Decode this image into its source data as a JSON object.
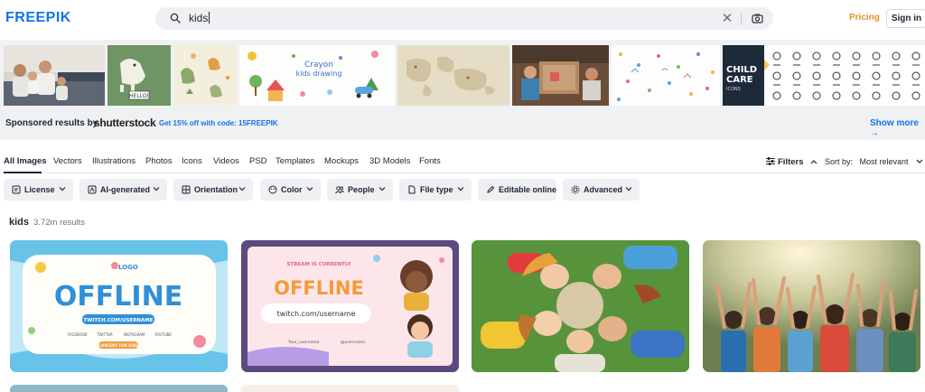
{
  "header": {
    "logo": "FREEPIK",
    "search_value": "kids",
    "pricing": "Pricing",
    "signin": "Sign in"
  },
  "sponsored": {
    "label": "Sponsored results by",
    "brand": "shutterstock",
    "offer": "Get 15% off with code: 15FREEPIK",
    "show_more": "Show more →",
    "thumb_texts": {
      "crayon": "Crayon\nkids drawing",
      "childcare_title_1": "CHILD",
      "childcare_title_2": "CARE",
      "childcare_sub": "ICONS",
      "hello": "HELLO!"
    }
  },
  "tabs": [
    {
      "label": "All Images",
      "active": true
    },
    {
      "label": "Vectors"
    },
    {
      "label": "Illustrations"
    },
    {
      "label": "Photos"
    },
    {
      "label": "Icons"
    },
    {
      "label": "Videos"
    },
    {
      "label": "PSD"
    },
    {
      "label": "Templates"
    },
    {
      "label": "Mockups"
    },
    {
      "label": "3D Models"
    },
    {
      "label": "Fonts"
    }
  ],
  "toolbar": {
    "filters": "Filters",
    "sort_label": "Sort by:",
    "sort_value": "Most relevant"
  },
  "chips": [
    {
      "label": "License",
      "icon": "license-icon"
    },
    {
      "label": "AI-generated",
      "icon": "ai-icon"
    },
    {
      "label": "Orientation",
      "icon": "orientation-icon"
    },
    {
      "label": "Color",
      "icon": "palette-icon"
    },
    {
      "label": "People",
      "icon": "people-icon"
    },
    {
      "label": "File type",
      "icon": "file-icon"
    },
    {
      "label": "Editable online",
      "icon": "pen-icon"
    },
    {
      "label": "Advanced",
      "icon": "gear-icon"
    }
  ],
  "results": {
    "query": "kids",
    "count": "3.72m results"
  },
  "cards": {
    "card1": {
      "logo": "LOGO",
      "title": "OFFLINE",
      "url": "TWITCH.COM/USERNAME",
      "socials": [
        "FACEBOOK",
        "TWITTER",
        "INSTAGRAM",
        "YOUTUBE"
      ],
      "footer": "CONTENT FOR KIDS"
    },
    "card2": {
      "kicker": "STREAM IS CURRENTLY",
      "title": "OFFLINE",
      "url": "twitch.com/username",
      "handle1": "Your_username",
      "handle2": "@username"
    }
  },
  "colors": {
    "brand_blue": "#1273eb",
    "pricing_orange": "#e48f2b"
  }
}
